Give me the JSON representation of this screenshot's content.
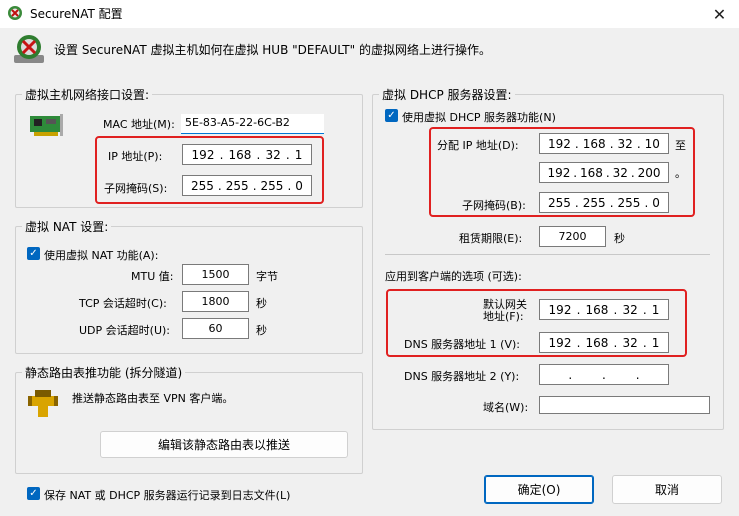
{
  "window": {
    "title": "SecureNAT 配置",
    "close": "✕"
  },
  "header": {
    "text": "设置 SecureNAT 虚拟主机如何在虚拟 HUB \"DEFAULT\" 的虚拟网络上进行操作。"
  },
  "host_iface": {
    "legend": "虚拟主机网络接口设置:",
    "mac_label": "MAC 地址(M):",
    "mac_value": "5E-83-A5-22-6C-B2",
    "ip_label": "IP 地址(P):",
    "ip": [
      "192",
      "168",
      "32",
      "1"
    ],
    "mask_label": "子网掩码(S):",
    "mask": [
      "255",
      "255",
      "255",
      "0"
    ]
  },
  "nat": {
    "legend": "虚拟 NAT 设置:",
    "use_label": "使用虚拟 NAT 功能(A):",
    "mtu_label": "MTU 值:",
    "mtu_value": "1500",
    "mtu_unit": "字节",
    "tcp_label": "TCP 会话超时(C):",
    "tcp_value": "1800",
    "tcp_unit": "秒",
    "udp_label": "UDP 会话超时(U):",
    "udp_value": "60",
    "udp_unit": "秒"
  },
  "static_route": {
    "legend": "静态路由表推功能 (拆分隧道)",
    "desc": "推送静态路由表至 VPN 客户端。",
    "button": "编辑该静态路由表以推送"
  },
  "dhcp": {
    "legend": "虚拟 DHCP 服务器设置:",
    "use_label": "使用虚拟 DHCP 服务器功能(N)",
    "alloc_label": "分配 IP 地址(D):",
    "start": [
      "192",
      "168",
      "32",
      "10"
    ],
    "to_label": "至",
    "end": [
      "192",
      "168",
      "32",
      "200"
    ],
    "dot": "。",
    "mask_label": "子网掩码(B):",
    "mask": [
      "255",
      "255",
      "255",
      "0"
    ],
    "lease_label": "租赁期限(E):",
    "lease_value": "7200",
    "lease_unit": "秒",
    "client_options": "应用到客户端的选项 (可选):",
    "gw_label_1": "默认网关",
    "gw_label_2": "地址(F):",
    "gw": [
      "192",
      "168",
      "32",
      "1"
    ],
    "dns1_label": "DNS 服务器地址 1 (V):",
    "dns1": [
      "192",
      "168",
      "32",
      "1"
    ],
    "dns2_label": "DNS 服务器地址 2 (Y):",
    "dns2": [
      "",
      "",
      "",
      ""
    ],
    "domain_label": "域名(W):",
    "domain_value": ""
  },
  "footer": {
    "log_label": "保存 NAT 或 DHCP 服务器运行记录到日志文件(L)",
    "ok": "确定(O)",
    "cancel": "取消"
  },
  "colors": {
    "highlight": "#e02020",
    "accent": "#0067c0",
    "background": "#f0f0f0"
  }
}
